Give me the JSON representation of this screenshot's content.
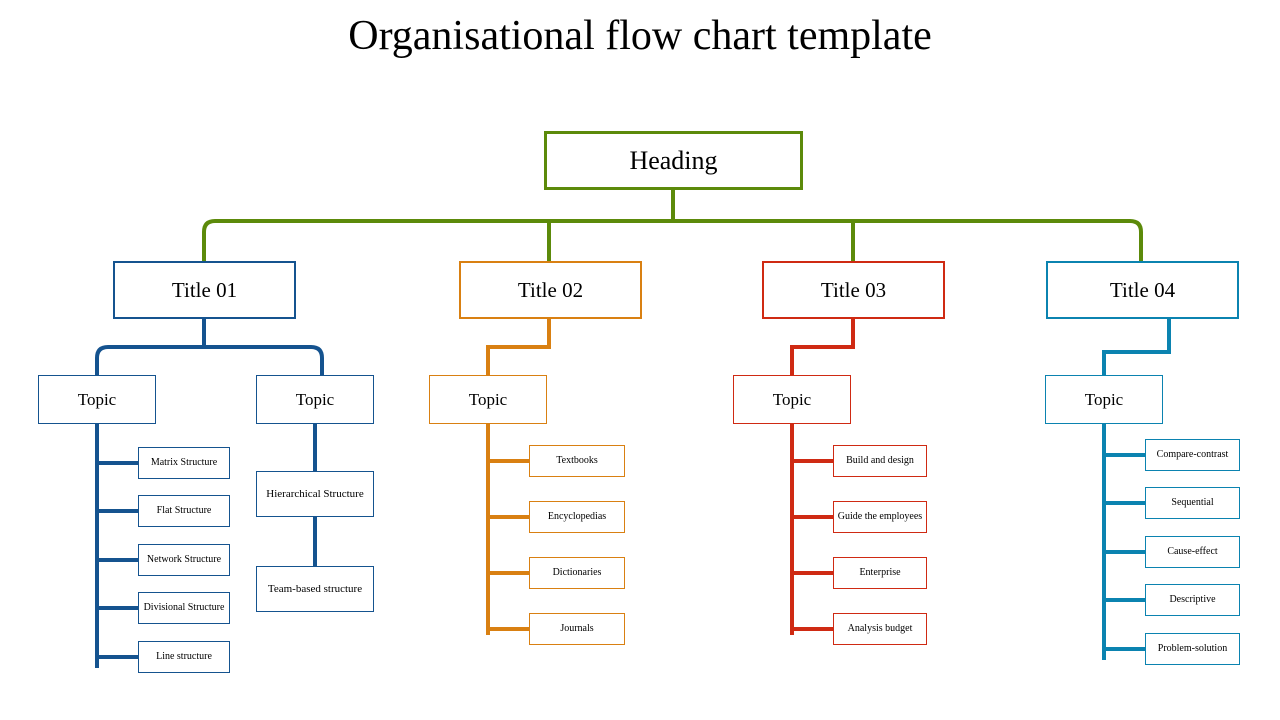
{
  "title": "Organisational flow chart template",
  "colors": {
    "heading": "#5c8a0a",
    "branch1": "#15538f",
    "branch2": "#d98012",
    "branch3": "#cf2a13",
    "branch4": "#0b83b0",
    "text": "#000000",
    "background": "#ffffff"
  },
  "chart_data": {
    "type": "diagram",
    "title": "Organisational flow chart template",
    "root": {
      "label": "Heading",
      "color": "#5c8a0a"
    },
    "branches": [
      {
        "label": "Title 01",
        "color": "#15538f",
        "topics": [
          {
            "label": "Topic",
            "style": "side-branch",
            "items": [
              "Matrix Structure",
              "Flat Structure",
              "Network Structure",
              "Divisional Structure",
              "Line structure"
            ]
          },
          {
            "label": "Topic",
            "style": "inline-stack",
            "items": [
              "Hierarchical  Structure",
              "Team-based  structure"
            ]
          }
        ]
      },
      {
        "label": "Title 02",
        "color": "#d98012",
        "topics": [
          {
            "label": "Topic",
            "style": "side-branch",
            "items": [
              "Textbooks",
              "Encyclopedias",
              "Dictionaries",
              "Journals"
            ]
          }
        ]
      },
      {
        "label": "Title 03",
        "color": "#cf2a13",
        "topics": [
          {
            "label": "Topic",
            "style": "side-branch",
            "items": [
              "Build and design",
              "Guide the employees",
              "Enterprise",
              "Analysis budget"
            ]
          }
        ]
      },
      {
        "label": "Title 04",
        "color": "#0b83b0",
        "topics": [
          {
            "label": "Topic",
            "style": "side-branch",
            "items": [
              "Compare-contrast",
              "Sequential",
              "Cause-effect",
              "Descriptive",
              "Problem-solution"
            ]
          }
        ]
      }
    ]
  },
  "nodes": {
    "heading": "Heading",
    "title_01": "Title 01",
    "title_02": "Title 02",
    "title_03": "Title 03",
    "title_04": "Title 04",
    "topic_1a": "Topic",
    "topic_1b": "Topic",
    "topic_2": "Topic",
    "topic_3": "Topic",
    "topic_4": "Topic",
    "b1_leaf_0": "Matrix Structure",
    "b1_leaf_1": "Flat Structure",
    "b1_leaf_2": "Network Structure",
    "b1_leaf_3": "Divisional Structure",
    "b1_leaf_4": "Line structure",
    "b1b_leaf_0": "Hierarchical  Structure",
    "b1b_leaf_1": "Team-based  structure",
    "b2_leaf_0": "Textbooks",
    "b2_leaf_1": "Encyclopedias",
    "b2_leaf_2": "Dictionaries",
    "b2_leaf_3": "Journals",
    "b3_leaf_0": "Build and design",
    "b3_leaf_1": "Guide the employees",
    "b3_leaf_2": "Enterprise",
    "b3_leaf_3": "Analysis budget",
    "b4_leaf_0": "Compare-contrast",
    "b4_leaf_1": "Sequential",
    "b4_leaf_2": "Cause-effect",
    "b4_leaf_3": "Descriptive",
    "b4_leaf_4": "Problem-solution"
  }
}
